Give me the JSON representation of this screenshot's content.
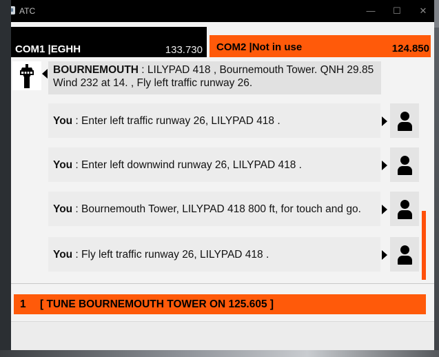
{
  "window": {
    "title": "ATC",
    "minimize": "—",
    "maximize": "☐",
    "close": "✕"
  },
  "com1": {
    "label": "COM1 |EGHH",
    "frequency": "133.730"
  },
  "com2": {
    "label": "COM2 |Not in use",
    "frequency": "124.850"
  },
  "atc_message": {
    "speaker": "BOURNEMOUTH",
    "text": " : LILYPAD 418 , Bournemouth Tower. QNH 29.85 Wind 232 at 14. , Fly left traffic runway 26."
  },
  "user_messages": [
    {
      "speaker": "You",
      "text": " : Enter left traffic runway 26, LILYPAD 418 ."
    },
    {
      "speaker": "You",
      "text": " : Enter left downwind runway 26, LILYPAD 418 ."
    },
    {
      "speaker": "You",
      "text": " : Bournemouth Tower, LILYPAD 418 800 ft, for touch and go."
    },
    {
      "speaker": "You",
      "text": " : Fly left traffic runway 26, LILYPAD 418 ."
    }
  ],
  "options": [
    {
      "number": "1",
      "label": "[ TUNE BOURNEMOUTH TOWER ON 125.605 ]"
    }
  ],
  "colors": {
    "accent": "#ff5a0a",
    "com1_bg": "#000000",
    "bubble": "#e1e1e1"
  },
  "icons": {
    "app": "atc-app-icon",
    "tower": "control-tower-icon",
    "user": "person-icon"
  }
}
